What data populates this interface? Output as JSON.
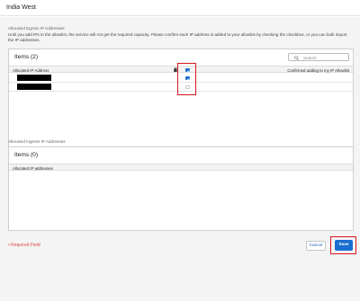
{
  "header": {
    "title": "India West"
  },
  "egress": {
    "section_title": "Allocated Egress IP Addresses",
    "description": "Until you add IPs to the allowlist, the service will not get the required capacity. Please confirm each IP address is added to your allowlist by checking the checkbox, or you can bulk import the IP addresses.",
    "items_title": "Items (2)",
    "search_placeholder": "Search",
    "col_address": "Allocated IP Address",
    "col_confirmed": "Confirmed adding to my IP Allowlist",
    "header_checkbox_checked": true,
    "rows": [
      {
        "address": "[redacted]",
        "confirmed": true
      },
      {
        "address": "[redacted]",
        "confirmed": false
      }
    ]
  },
  "ingress": {
    "section_title": "Allocated Ingress IP Addresses",
    "items_title": "Items (0)",
    "col_address": "Allocated IP addresses"
  },
  "footer": {
    "required_field": "• Required Field",
    "cancel_label": "Cancel",
    "save_label": "Save"
  },
  "colors": {
    "accent": "#1a6fd1",
    "highlight": "#d8141f",
    "required": "#e04848"
  },
  "icons": [
    "search-icon",
    "copy-icon",
    "checkbox-icon"
  ]
}
